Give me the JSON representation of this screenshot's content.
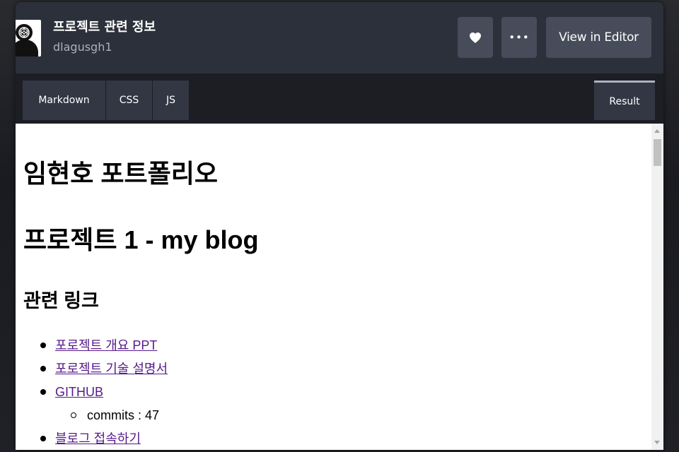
{
  "header": {
    "project_title": "프로젝트 관련 정보",
    "author": "dlagusgh1",
    "avatar_icon": "user-avatar-icon",
    "heart_icon": "heart-icon",
    "more_icon": "more-dots-icon",
    "more_label": "•••",
    "view_in_editor_label": "View in Editor"
  },
  "tabs": [
    {
      "label": "Markdown"
    },
    {
      "label": "CSS"
    },
    {
      "label": "JS"
    }
  ],
  "result_tab": {
    "label": "Result",
    "active": true
  },
  "content": {
    "heading1": "임현호 포트폴리오",
    "heading2": "프로젝트 1 - my blog",
    "subheading": "관련 링크",
    "links": [
      {
        "text": "포로젝트 개요 PPT"
      },
      {
        "text": "포로젝트 기술 설명서"
      },
      {
        "text": "GITHUB"
      },
      {
        "text": "블로그 접속하기"
      }
    ],
    "github_sub": "commits : 47"
  },
  "colors": {
    "header_bg": "#2c303a",
    "button_bg": "#474c5a",
    "tab_bg": "#333744",
    "tabbar_bg": "#1d1e23",
    "link_visited": "#551a8b"
  }
}
